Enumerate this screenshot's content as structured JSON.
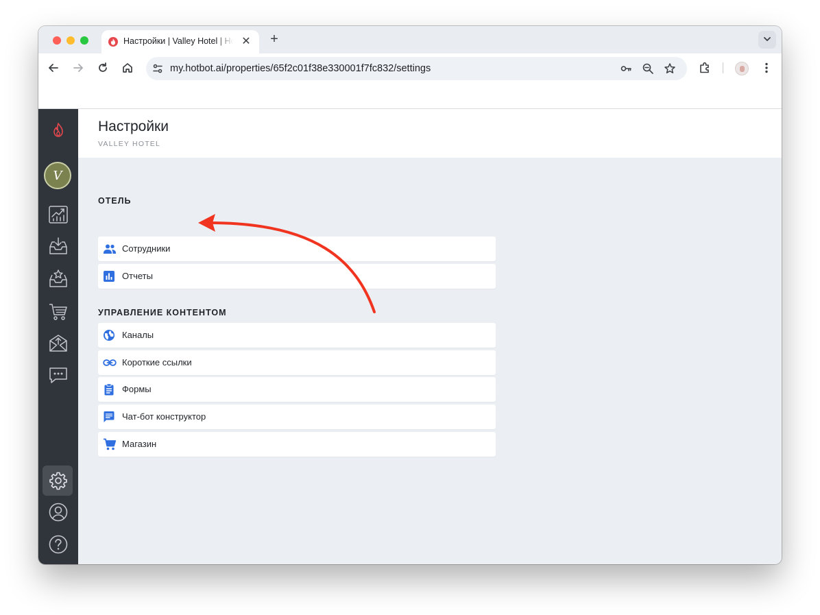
{
  "browser": {
    "tab_title": "Настройки | Valley Hotel | Hotbot",
    "tab_close": "✕",
    "new_tab": "+",
    "url": "my.hotbot.ai/properties/65f2c01f38e330001f7fc832/settings"
  },
  "sidebar": {
    "logo_icon": "flame-icon",
    "avatar_initial": "V",
    "items": [
      {
        "name": "analytics-icon"
      },
      {
        "name": "inbox-download-icon"
      },
      {
        "name": "inbox-star-icon"
      },
      {
        "name": "shopping-cart-icon"
      },
      {
        "name": "mail-upload-icon"
      },
      {
        "name": "chat-bubble-icon"
      },
      {
        "name": "settings-gear-icon",
        "active": true
      },
      {
        "name": "user-circle-icon"
      },
      {
        "name": "help-circle-icon"
      }
    ]
  },
  "page": {
    "title": "Настройки",
    "subtitle": "VALLEY HOTEL"
  },
  "sections": [
    {
      "title": "ОТЕЛЬ",
      "items": [
        {
          "label": "Сотрудники",
          "icon": "people-icon"
        },
        {
          "label": "Отчеты",
          "icon": "bar-chart-icon"
        }
      ]
    },
    {
      "title": "УПРАВЛЕНИЕ КОНТЕНТОМ",
      "items": [
        {
          "label": "Каналы",
          "icon": "globe-icon"
        },
        {
          "label": "Короткие ссылки",
          "icon": "link-icon"
        },
        {
          "label": "Формы",
          "icon": "clipboard-icon"
        },
        {
          "label": "Чат-бот конструктор",
          "icon": "chat-message-icon"
        },
        {
          "label": "Магазин",
          "icon": "cart-icon"
        }
      ]
    }
  ],
  "colors": {
    "accent_blue": "#2f6fe0",
    "annotation_red": "#f0341f",
    "sidebar_bg": "#30343b",
    "content_bg": "#ebeef2"
  }
}
